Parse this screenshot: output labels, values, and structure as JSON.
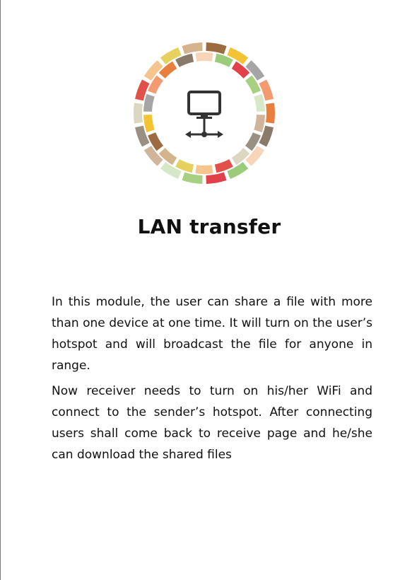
{
  "document": {
    "title": "LAN transfer",
    "paragraphs": [
      "In this module, the user can share a file with more than one device at one time. It will turn on the user’s hotspot and will broadcast the file for anyone in range.",
      "Now receiver needs to turn on his/her WiFi and connect to the sender’s hotspot. After connecting users shall come back to receive page and he/she can download the shared files"
    ]
  },
  "logo": {
    "icon": "lan-network-monitor-icon",
    "ring_colors": [
      "#9bcc7a",
      "#a5a5a5",
      "#f6c48d",
      "#d6e8c8",
      "#8a7a6a",
      "#9c6b3f",
      "#dcd7c0",
      "#e0414a",
      "#f49a70",
      "#e6d160",
      "#d0b49c",
      "#f8d4b8",
      "#f2c433",
      "#e2504a",
      "#a8d083",
      "#e87f3c",
      "#d4b48c",
      "#9a8f83"
    ],
    "icon_color": "#333333"
  }
}
